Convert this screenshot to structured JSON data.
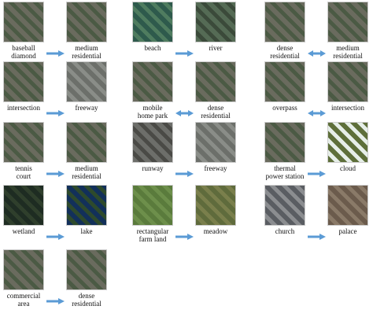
{
  "pairs": [
    {
      "from": "baseball\ndiamond",
      "to": "medium\nresidential",
      "arrow": "right"
    },
    {
      "from": "beach",
      "to": "river",
      "arrow": "right"
    },
    {
      "from": "dense\nresidential",
      "to": "medium\nresidential",
      "arrow": "both"
    },
    {
      "from": "intersection",
      "to": "freeway",
      "arrow": "right"
    },
    {
      "from": "mobile\nhome park",
      "to": "dense\nresidential",
      "arrow": "both"
    },
    {
      "from": "overpass",
      "to": "intersection",
      "arrow": "both"
    },
    {
      "from": "tennis\ncourt",
      "to": "medium\nresidential",
      "arrow": "right"
    },
    {
      "from": "runway",
      "to": "freeway",
      "arrow": "right"
    },
    {
      "from": "thermal\npower station",
      "to": "cloud",
      "arrow": "right"
    },
    {
      "from": "wetland",
      "to": "lake",
      "arrow": "right"
    },
    {
      "from": "rectangular\nfarm land",
      "to": "meadow",
      "arrow": "right"
    },
    {
      "from": "church",
      "to": "palace",
      "arrow": "right"
    },
    {
      "from": "commercial\narea",
      "to": "dense\nresidential",
      "arrow": "right"
    }
  ],
  "colors": {
    "arrow": "#5b9bd5"
  }
}
